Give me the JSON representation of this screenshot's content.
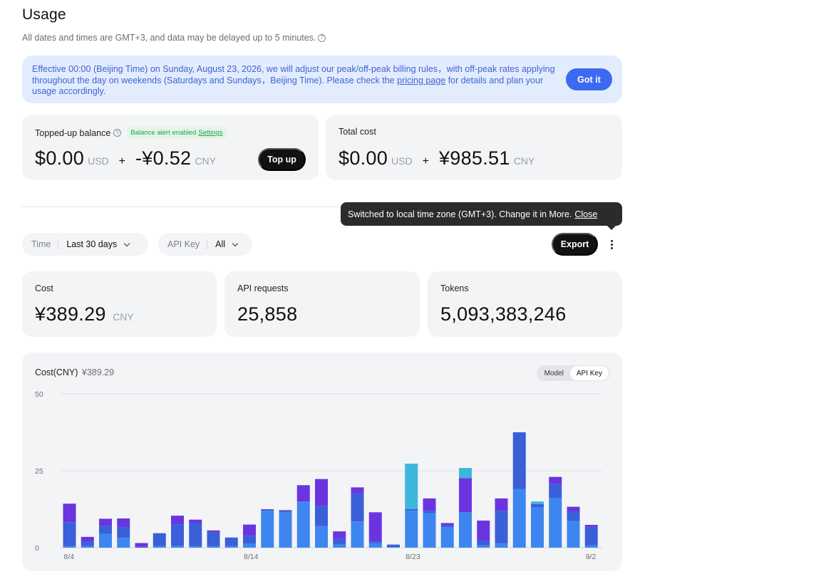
{
  "header": {
    "title": "Usage",
    "subtitle": "All dates and times are GMT+3, and data may be delayed up to 5 minutes.",
    "help_glyph": "?"
  },
  "notice": {
    "text_before": "Effective 00:00 (Beijing Time) on Sunday, August 23, 2026, we will adjust our peak/off-peak billing rules，with off-peak rates applying throughout the day on weekends (Saturdays and Sundays，Beijing Time). Please check the ",
    "link": "pricing page",
    "text_after": " for details and plan your usage accordingly.",
    "button": "Got it"
  },
  "balance": {
    "label": "Topped-up balance",
    "alert_text": "Balance alert enabled",
    "settings_link": "Settings",
    "usd_amount": "$0.00",
    "usd_unit": "USD",
    "plus": "+",
    "cny_amount": "-¥0.52",
    "cny_unit": "CNY",
    "topup_button": "Top up"
  },
  "total_cost": {
    "label": "Total cost",
    "usd_amount": "$0.00",
    "usd_unit": "USD",
    "plus": "+",
    "cny_amount": "¥985.51",
    "cny_unit": "CNY"
  },
  "tooltip": {
    "text": "Switched to local time zone (GMT+3). Change it in More.",
    "close": "Close"
  },
  "filters": {
    "time_label": "Time",
    "time_value": "Last 30 days",
    "apikey_label": "API Key",
    "apikey_value": "All",
    "export": "Export"
  },
  "stats": {
    "cost_label": "Cost",
    "cost_value": "¥389.29",
    "cost_unit": "CNY",
    "requests_label": "API requests",
    "requests_value": "25,858",
    "tokens_label": "Tokens",
    "tokens_value": "5,093,383,246"
  },
  "chart_header": {
    "title": "Cost(CNY)",
    "amount": "¥389.29",
    "toggle_model": "Model",
    "toggle_apikey": "API Key"
  },
  "colors": {
    "blue": "#3d86f0",
    "indigo": "#3a5fd9",
    "purple": "#6a35e0",
    "cyan": "#3db6dc",
    "accent": "#3d6af2"
  },
  "chart_data": {
    "type": "bar",
    "stacked": true,
    "ylim": [
      0,
      50
    ],
    "yticks": [
      0,
      25,
      50
    ],
    "grid": true,
    "x_tick_labels": [
      {
        "index": 0,
        "label": "8/4"
      },
      {
        "index": 10,
        "label": "8/14"
      },
      {
        "index": 19,
        "label": "8/23"
      },
      {
        "index": 29,
        "label": "9/2"
      }
    ],
    "categories": [
      "8/4",
      "8/5",
      "8/6",
      "8/7",
      "8/8",
      "8/9",
      "8/10",
      "8/11",
      "8/12",
      "8/13",
      "8/14",
      "8/15",
      "8/16",
      "8/17",
      "8/18",
      "8/19",
      "8/20",
      "8/21",
      "8/22",
      "8/23",
      "8/24",
      "8/25",
      "8/26",
      "8/27",
      "8/28",
      "8/29",
      "8/30",
      "8/31",
      "9/1",
      "9/2"
    ],
    "series": [
      {
        "color_key": "blue",
        "values": [
          0.5,
          0.5,
          4.5,
          3.2,
          0,
          0.5,
          0.6,
          0.5,
          0.5,
          0.5,
          1.3,
          12,
          11.5,
          15,
          7,
          1,
          8.5,
          1.5,
          0.2,
          12,
          11.2,
          6.7,
          11.5,
          0.8,
          1.5,
          19,
          13.2,
          16.2,
          8.6,
          0.8
        ]
      },
      {
        "color_key": "indigo",
        "values": [
          7.8,
          1.5,
          2.6,
          3.5,
          0.3,
          4.2,
          7,
          7.6,
          4.5,
          2.8,
          2.6,
          0.5,
          0.5,
          0,
          6.5,
          1.8,
          9.2,
          0.5,
          0.8,
          0.5,
          0.8,
          0.5,
          0,
          1.5,
          10.5,
          18.5,
          1,
          4.6,
          3.2,
          6
        ]
      },
      {
        "color_key": "purple",
        "values": [
          6,
          1.5,
          2.3,
          2.8,
          1.2,
          0,
          2.8,
          1,
          0.6,
          0,
          3.6,
          0,
          0.2,
          5.3,
          8.8,
          2.5,
          1.9,
          9.5,
          0,
          0,
          4,
          0.8,
          11.1,
          6.5,
          4,
          0,
          0,
          2.2,
          1.5,
          0.6
        ]
      },
      {
        "color_key": "cyan",
        "values": [
          0,
          0,
          0,
          0,
          0,
          0,
          0,
          0,
          0,
          0,
          0,
          0,
          0,
          0,
          0,
          0,
          0,
          0,
          0,
          14.8,
          0,
          0,
          3.3,
          0,
          0,
          0,
          0.8,
          0,
          0,
          0
        ]
      }
    ]
  }
}
